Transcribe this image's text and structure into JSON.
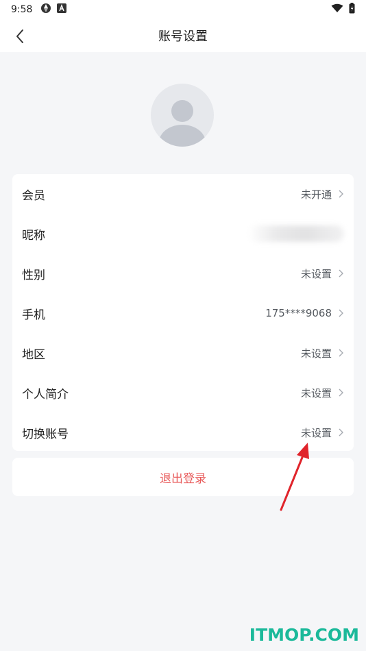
{
  "status_bar": {
    "time": "9:58",
    "icons": [
      "aperture-icon",
      "a-badge-icon",
      "wifi-icon",
      "battery-icon"
    ]
  },
  "header": {
    "title": "账号设置",
    "back_icon": "chevron-left-icon"
  },
  "avatar": {
    "icon": "default-avatar-icon"
  },
  "settings": {
    "rows": [
      {
        "label": "会员",
        "value": "未开通"
      },
      {
        "label": "昵称",
        "value": ""
      },
      {
        "label": "性别",
        "value": "未设置"
      },
      {
        "label": "手机",
        "value": "175****9068"
      },
      {
        "label": "地区",
        "value": "未设置"
      },
      {
        "label": "个人简介",
        "value": "未设置"
      },
      {
        "label": "切换账号",
        "value": "未设置"
      }
    ]
  },
  "logout": {
    "label": "退出登录"
  },
  "watermark": {
    "text": "ITMOP.COM"
  },
  "colors": {
    "background": "#f5f6f8",
    "card": "#ffffff",
    "logout_text": "#e85a5a",
    "annotation_arrow": "#e0242b",
    "watermark": "#1bb99a"
  }
}
